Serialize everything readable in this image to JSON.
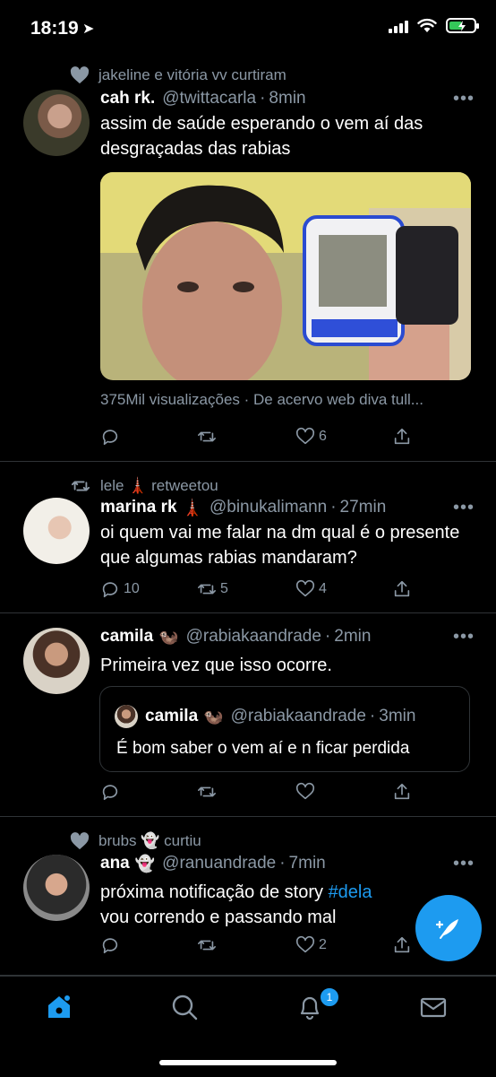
{
  "status_bar": {
    "time": "18:19",
    "location_glyph": "➤",
    "battery_color": "#34c759"
  },
  "tweets": [
    {
      "social_context": "jakeline e vitória vv curtiram",
      "social_icon": "heart-filled-icon",
      "name": "cah rk.",
      "name_emoji": "",
      "handle": "@twittacarla",
      "time": "8min",
      "text": "assim de saúde esperando o vem aí das desgraçadas das rabias",
      "media_caption": "375Mil visualizações · De acervo web diva tull...",
      "replies": "",
      "retweets": "",
      "likes": "6"
    },
    {
      "social_context": "lele 🗼 retweetou",
      "social_icon": "retweet-icon",
      "name": "marina rk",
      "name_emoji": "🗼",
      "handle": "@binukalimann",
      "time": "27min",
      "text": "oi quem vai me falar na dm qual é o presente que algumas rabias mandaram?",
      "replies": "10",
      "retweets": "5",
      "likes": "4"
    },
    {
      "name": "camila",
      "name_emoji": "🦦",
      "handle": "@rabiakaandrade",
      "time": "2min",
      "text": "Primeira vez que isso ocorre.",
      "quote": {
        "name": "camila",
        "name_emoji": "🦦",
        "handle": "@rabiakaandrade",
        "time": "3min",
        "text": "É bom saber o vem aí e n ficar perdida"
      },
      "replies": "",
      "retweets": "",
      "likes": ""
    },
    {
      "social_context": "brubs 👻 curtiu",
      "social_icon": "heart-filled-icon",
      "name": "ana",
      "name_emoji": "👻",
      "handle": "@ranuandrade",
      "time": "7min",
      "text_before": "próxima notificação de story ",
      "hashtag": "#dela",
      "text_after": " vou correndo e passando mal",
      "replies": "",
      "retweets": "",
      "likes": "2"
    }
  ],
  "tabbar": {
    "notifications_badge": "1",
    "accent": "#1d9bf0"
  },
  "separator": "·",
  "more_glyph": "•••"
}
